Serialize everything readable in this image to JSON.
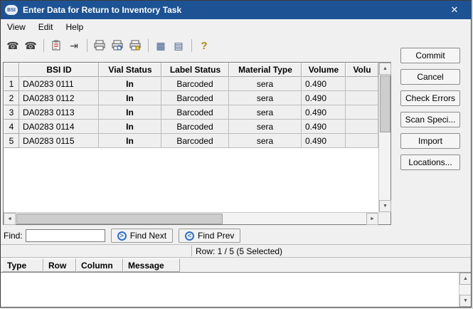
{
  "window": {
    "title": "Enter Data for Return to Inventory Task",
    "icon_text": "BSI",
    "close_glyph": "✕"
  },
  "menu": {
    "items": [
      "View",
      "Edit",
      "Help"
    ]
  },
  "toolbar": {
    "icons": [
      {
        "name": "phone-dial-icon",
        "glyph": "☎"
      },
      {
        "name": "phone-answer-icon",
        "glyph": "☎"
      },
      {
        "name": "paste-errors-icon",
        "glyph": ""
      },
      {
        "name": "fill-column-icon",
        "glyph": "⇥"
      },
      {
        "name": "print-icon",
        "glyph": ""
      },
      {
        "name": "print-preview-icon",
        "glyph": ""
      },
      {
        "name": "print-setup-icon",
        "glyph": ""
      },
      {
        "name": "grid-view-icon",
        "glyph": "▦"
      },
      {
        "name": "grid-alt-view-icon",
        "glyph": "▤"
      },
      {
        "name": "help-icon",
        "glyph": "?"
      }
    ]
  },
  "grid": {
    "columns": [
      "",
      "BSI ID",
      "Vial Status",
      "Label Status",
      "Material Type",
      "Volume",
      "Volu"
    ],
    "rows": [
      {
        "num": "1",
        "bsi_id": "DA0283 0111",
        "vial_status": "In",
        "label_status": "Barcoded",
        "material_type": "sera",
        "volume": "0.490",
        "volume2": ""
      },
      {
        "num": "2",
        "bsi_id": "DA0283 0112",
        "vial_status": "In",
        "label_status": "Barcoded",
        "material_type": "sera",
        "volume": "0.490",
        "volume2": ""
      },
      {
        "num": "3",
        "bsi_id": "DA0283 0113",
        "vial_status": "In",
        "label_status": "Barcoded",
        "material_type": "sera",
        "volume": "0.490",
        "volume2": ""
      },
      {
        "num": "4",
        "bsi_id": "DA0283 0114",
        "vial_status": "In",
        "label_status": "Barcoded",
        "material_type": "sera",
        "volume": "0.490",
        "volume2": ""
      },
      {
        "num": "5",
        "bsi_id": "DA0283 0115",
        "vial_status": "In",
        "label_status": "Barcoded",
        "material_type": "sera",
        "volume": "0.490",
        "volume2": ""
      }
    ]
  },
  "find": {
    "label": "Find:",
    "value": "",
    "next_label": "Find Next",
    "prev_label": "Find Prev",
    "next_icon_glyph": ">",
    "prev_icon_glyph": "<"
  },
  "status": {
    "row_info": "Row: 1 / 5 (5 Selected)"
  },
  "errors": {
    "columns": [
      "Type",
      "Row",
      "Column",
      "Message"
    ],
    "rows": []
  },
  "side_buttons": [
    "Commit",
    "Cancel",
    "Check Errors",
    "Scan Speci...",
    "Import",
    "Locations..."
  ],
  "scrollbar": {
    "up": "▲",
    "down": "▼",
    "left": "◄",
    "right": "►"
  },
  "colors": {
    "titlebar": "#1d5394",
    "header_bg": "#f0f0f0",
    "cell_bg": "#efefef",
    "accent_blue": "#2f6fd0"
  }
}
